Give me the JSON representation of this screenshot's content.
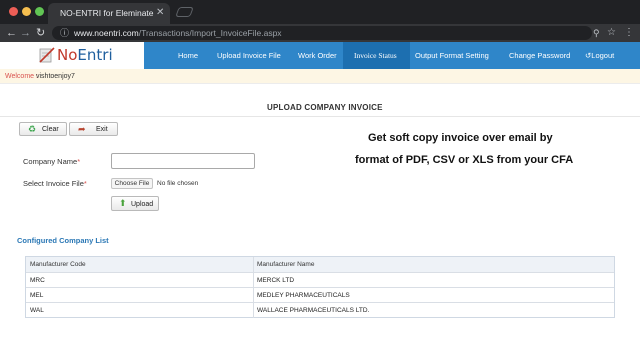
{
  "browser": {
    "tab_title": "NO-ENTRI for Eleminate Data",
    "tab_close": "✕",
    "url_host": "www.noentri.com",
    "url_path": "/Transactions/Import_InvoiceFile.aspx"
  },
  "site": {
    "logo_no": "No",
    "logo_entri": "Entri",
    "nav": [
      {
        "label": "Home"
      },
      {
        "label": "Upload Invoice File"
      },
      {
        "label": "Work Order"
      },
      {
        "label": "Invoice Status"
      },
      {
        "label": "Output Format Setting"
      },
      {
        "label": "Change Password"
      },
      {
        "label": "Logout"
      }
    ],
    "welcome_label": "Welcome :",
    "welcome_user": "vishtoenjoy7",
    "accent_color": "#2f86c9"
  },
  "page": {
    "heading": "UPLOAD COMPANY INVOICE",
    "clear_label": "Clear",
    "exit_label": "Exit",
    "promo_line1": "Get soft copy invoice over email by",
    "promo_line2": "format of PDF, CSV or XLS from your CFA",
    "company_label": "Company Name",
    "file_label": "Select Invoice File",
    "required_mark": "*",
    "company_value": "",
    "file_button": "Choose File",
    "file_status": "No file chosen",
    "upload_label": "Upload",
    "section_title": "Configured Company List"
  },
  "grid": {
    "columns": [
      "Manufacturer Code",
      "Manufacturer Name"
    ],
    "rows": [
      [
        "MRC",
        "MERCK LTD"
      ],
      [
        "MEL",
        "MEDLEY PHARMACEUTICALS"
      ],
      [
        "WAL",
        "WALLACE PHARMACEUTICALS LTD."
      ]
    ]
  }
}
